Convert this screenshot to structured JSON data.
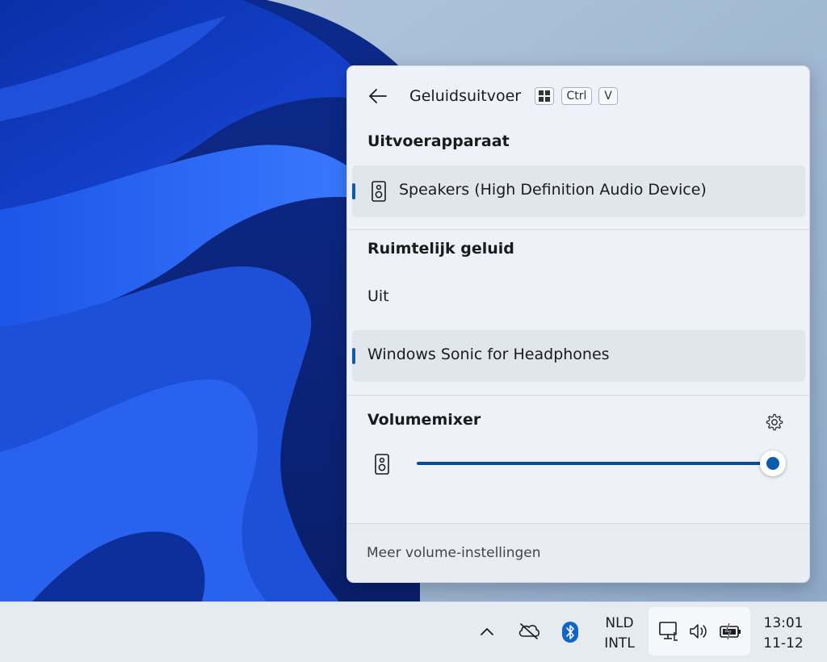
{
  "flyout": {
    "title": "Geluidsuitvoer",
    "shortcut_keys": [
      "Ctrl",
      "V"
    ],
    "output_section": {
      "title": "Uitvoerapparaat",
      "devices": [
        {
          "label": "Speakers (High Definition Audio Device)",
          "selected": true
        }
      ]
    },
    "spatial_section": {
      "title": "Ruimtelijk geluid",
      "options": [
        {
          "label": "Uit",
          "selected": false
        },
        {
          "label": "Windows Sonic for Headphones",
          "selected": true
        }
      ]
    },
    "mixer": {
      "title": "Volumemixer",
      "volume_percent": 100
    },
    "footer_link": "Meer volume-instellingen"
  },
  "taskbar": {
    "language_line1": "NLD",
    "language_line2": "INTL",
    "time": "13:01",
    "date": "11-12"
  },
  "icons": [
    "back-arrow-icon",
    "windows-key-icon",
    "speaker-icon",
    "gear-icon",
    "chevron-up-icon",
    "onedrive-offline-icon",
    "bluetooth-icon",
    "network-icon",
    "volume-icon",
    "battery-charging-icon"
  ],
  "colors": {
    "accent": "#0b5cad",
    "wallpaper_blue": "#1f4fd1"
  }
}
